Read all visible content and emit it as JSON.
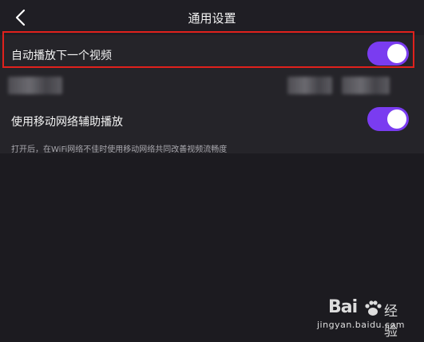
{
  "header": {
    "title": "通用设置",
    "back_icon": "chevron-left-icon"
  },
  "settings": {
    "autoplay": {
      "label": "自动播放下一个视频",
      "enabled": true
    },
    "mobile_assist": {
      "label": "使用移动网络辅助播放",
      "enabled": true
    },
    "hint": "打开后，在WiFi网络不佳时使用移动网络共同改善视频流畅度"
  },
  "colors": {
    "toggle_on": "#7a3cf0",
    "highlight_border": "#e0211c",
    "background": "#1c1b20",
    "panel": "#252429"
  },
  "watermark": {
    "logo": "Bai",
    "logo_icon": "paw-icon",
    "suffix": "经验",
    "url": "jingyan.baidu.com"
  }
}
